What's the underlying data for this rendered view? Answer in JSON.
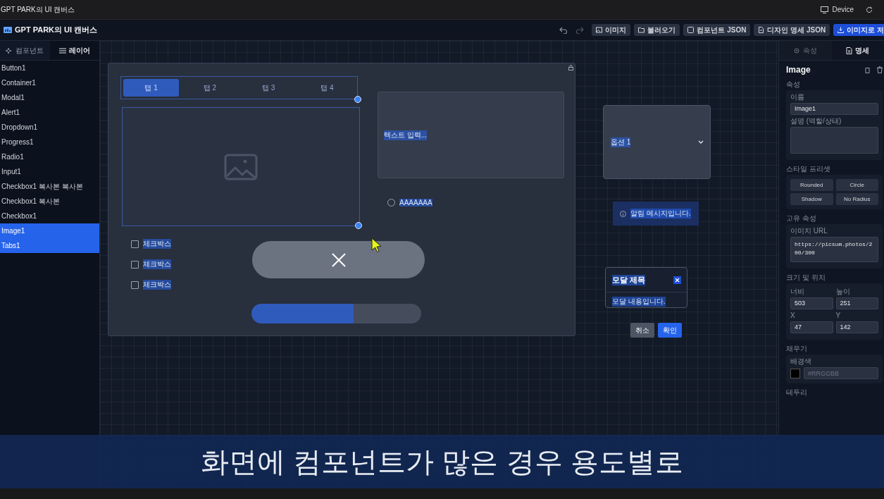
{
  "os_bar": {
    "title": "GPT PARK의 UI 캔버스",
    "device": "Device"
  },
  "header": {
    "title": "GPT PARK의 UI 캔버스",
    "toolbar": [
      {
        "label": "이미지",
        "kind": "normal"
      },
      {
        "label": "불러오기",
        "kind": "normal"
      },
      {
        "label": "컴포넌트 JSON",
        "kind": "normal"
      },
      {
        "label": "디자인 명세 JSON",
        "kind": "normal"
      },
      {
        "label": "이미지로 저",
        "kind": "primary"
      }
    ]
  },
  "sidebar": {
    "tabs": [
      {
        "label": "컴포넌트",
        "selected": false
      },
      {
        "label": "레이어",
        "selected": true
      }
    ],
    "items": [
      {
        "label": "Button1",
        "selected": false
      },
      {
        "label": "Container1",
        "selected": false
      },
      {
        "label": "Modal1",
        "selected": false
      },
      {
        "label": "Alert1",
        "selected": false
      },
      {
        "label": "Dropdown1",
        "selected": false
      },
      {
        "label": "Progress1",
        "selected": false
      },
      {
        "label": "Radio1",
        "selected": false
      },
      {
        "label": "Input1",
        "selected": false
      },
      {
        "label": "Checkbox1 복사본 복사본",
        "selected": false
      },
      {
        "label": "Checkbox1 복사본",
        "selected": false
      },
      {
        "label": "Checkbox1",
        "selected": false
      },
      {
        "label": "Image1",
        "selected": true
      },
      {
        "label": "Tabs1",
        "selected": true
      }
    ]
  },
  "canvas": {
    "tabs": [
      {
        "label": "탭 1",
        "selected": true
      },
      {
        "label": "탭 2",
        "selected": false
      },
      {
        "label": "탭 3",
        "selected": false
      },
      {
        "label": "탭 4",
        "selected": false
      }
    ],
    "textarea": {
      "placeholder": "텍스트 입력..."
    },
    "radio": {
      "label": "AAAAAAA",
      "checked": false
    },
    "checkboxes": [
      {
        "label": "체크박스",
        "checked": false
      },
      {
        "label": "체크박스",
        "checked": false
      },
      {
        "label": "체크박스",
        "checked": false
      }
    ],
    "progress": {
      "level": 0.6
    },
    "dropdown": {
      "value": "옵션 1"
    },
    "alert": {
      "message": "알림 메시지입니다."
    },
    "modal": {
      "title": "모달 제목",
      "body": "모달 내용입니다.",
      "buttons": [
        {
          "label": "취소",
          "kind": "secondary"
        },
        {
          "label": "확인",
          "kind": "primary"
        }
      ]
    }
  },
  "panel": {
    "tabs": [
      {
        "label": "속성",
        "selected": false
      },
      {
        "label": "명세",
        "selected": true
      }
    ],
    "heading": "Image",
    "basic": {
      "title": "속성",
      "name_label": "이름",
      "name_value": "Image1",
      "desc_label": "설명 (역할/상태)"
    },
    "presets": {
      "title": "스타일 프리셋",
      "buttons": [
        "Rounded",
        "Circle",
        "Shadow",
        "No Radius"
      ]
    },
    "own": {
      "title": "고유 속성",
      "url_label": "이미지 URL",
      "url_value": "https://picsum.photos/200/300"
    },
    "size": {
      "title": "크기 및 위치",
      "fields": [
        {
          "label": "너비",
          "value": "503"
        },
        {
          "label": "높이",
          "value": "251"
        },
        {
          "label": "X",
          "value": "47"
        },
        {
          "label": "Y",
          "value": "142"
        }
      ]
    },
    "fill": {
      "title": "채우기",
      "label": "배경색",
      "placeholder": "#RRGGBB"
    },
    "border": {
      "title": "테두리"
    }
  },
  "caption": "화면에 컴포넌트가 많은 경우 용도별로"
}
